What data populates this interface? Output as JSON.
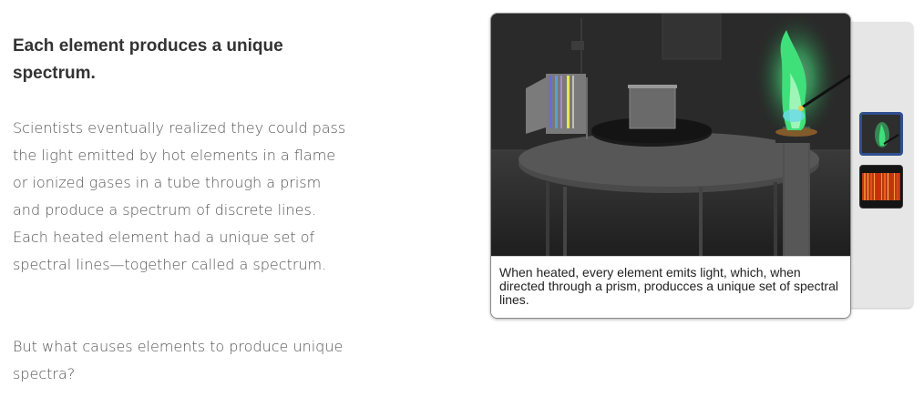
{
  "article": {
    "heading": "Each element produces a unique spectrum.",
    "paragraph1": "Scientists eventually realized they could pass the light emitted by hot elements in a flame or ionized gases in a tube through a prism and produce a spectrum of discrete lines. Each heated element had a unique set of spectral lines—together called a spectrum.",
    "paragraph2": "But what causes elements to produce unique spectra?"
  },
  "viewer": {
    "caption": "When heated, every element emits light, which, when directed through a prism, producces a unique set of spectral lines.",
    "thumbnails": [
      {
        "icon": "flame-thumbnail",
        "selected": true
      },
      {
        "icon": "spectrum-thumbnail",
        "selected": false
      }
    ]
  },
  "colors": {
    "flame": "#3fe07a",
    "thumb_border_selected": "#2f4f8f",
    "spectrum_red": "#d94a1e"
  }
}
